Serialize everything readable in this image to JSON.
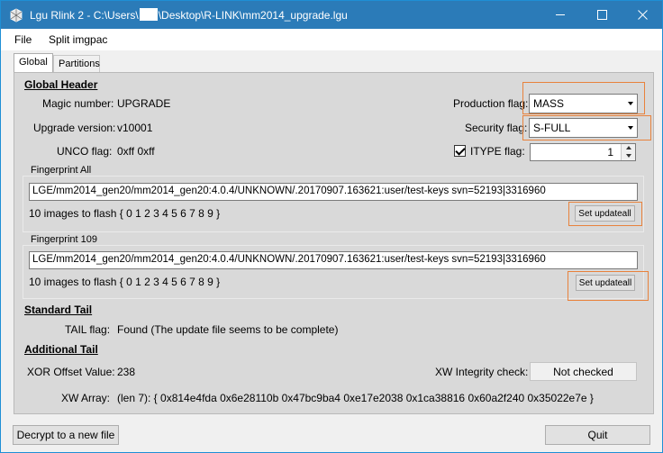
{
  "window": {
    "title_prefix": "Lgu Rlink 2 - C:\\Users\\",
    "title_suffix": "\\Desktop\\R-LINK\\mm2014_upgrade.lgu",
    "icons": [
      "app-icon",
      "minimize-icon",
      "maximize-icon",
      "close-icon"
    ]
  },
  "menu": {
    "file": "File",
    "split": "Split imgpac"
  },
  "tabs": {
    "global": "Global",
    "partitions": "Partitions"
  },
  "global_header": {
    "heading": "Global Header",
    "magic_label": "Magic number:",
    "magic_value": "UPGRADE",
    "version_label": "Upgrade version:",
    "version_value": "v10001",
    "unco_label": "UNCO flag:",
    "unco_value": "0xff 0xff",
    "production_label": "Production flag:",
    "production_value": "MASS",
    "security_label": "Security flag:",
    "security_value": "S-FULL",
    "itype_label": "ITYPE flag:",
    "itype_checked": true,
    "itype_value": "1"
  },
  "fingerprint_all": {
    "label": "Fingerprint All",
    "value": "LGE/mm2014_gen20/mm2014_gen20:4.0.4/UNKNOWN/.20170907.163621:user/test-keys svn=52193|3316960",
    "images": "10 images to flash { 0 1 2 3 4 5 6 7 8 9 }",
    "button": "Set updateall"
  },
  "fingerprint_109": {
    "label": "Fingerprint 109",
    "value": "LGE/mm2014_gen20/mm2014_gen20:4.0.4/UNKNOWN/.20170907.163621:user/test-keys svn=52193|3316960",
    "images": "10 images to flash { 0 1 2 3 4 5 6 7 8 9 }",
    "button": "Set updateall"
  },
  "standard_tail": {
    "heading": "Standard Tail",
    "tail_label": "TAIL flag:",
    "tail_value": "Found (The update file seems to be complete)"
  },
  "additional_tail": {
    "heading": "Additional Tail",
    "xor_label": "XOR Offset Value:",
    "xor_value": "238",
    "xw_integrity_label": "XW Integrity check:",
    "xw_integrity_value": "Not checked",
    "xw_array_label": "XW Array:",
    "xw_array_value": "(len 7): { 0x814e4fda 0x6e28110b 0x47bc9ba4 0xe17e2038 0x1ca38816 0x60a2f240 0x35022e7e }"
  },
  "footer": {
    "decrypt": "Decrypt to a new file",
    "quit": "Quit"
  },
  "colors": {
    "titlebar": "#2b7bb8",
    "highlight": "#e8823c",
    "panel": "#d9d9d9"
  }
}
